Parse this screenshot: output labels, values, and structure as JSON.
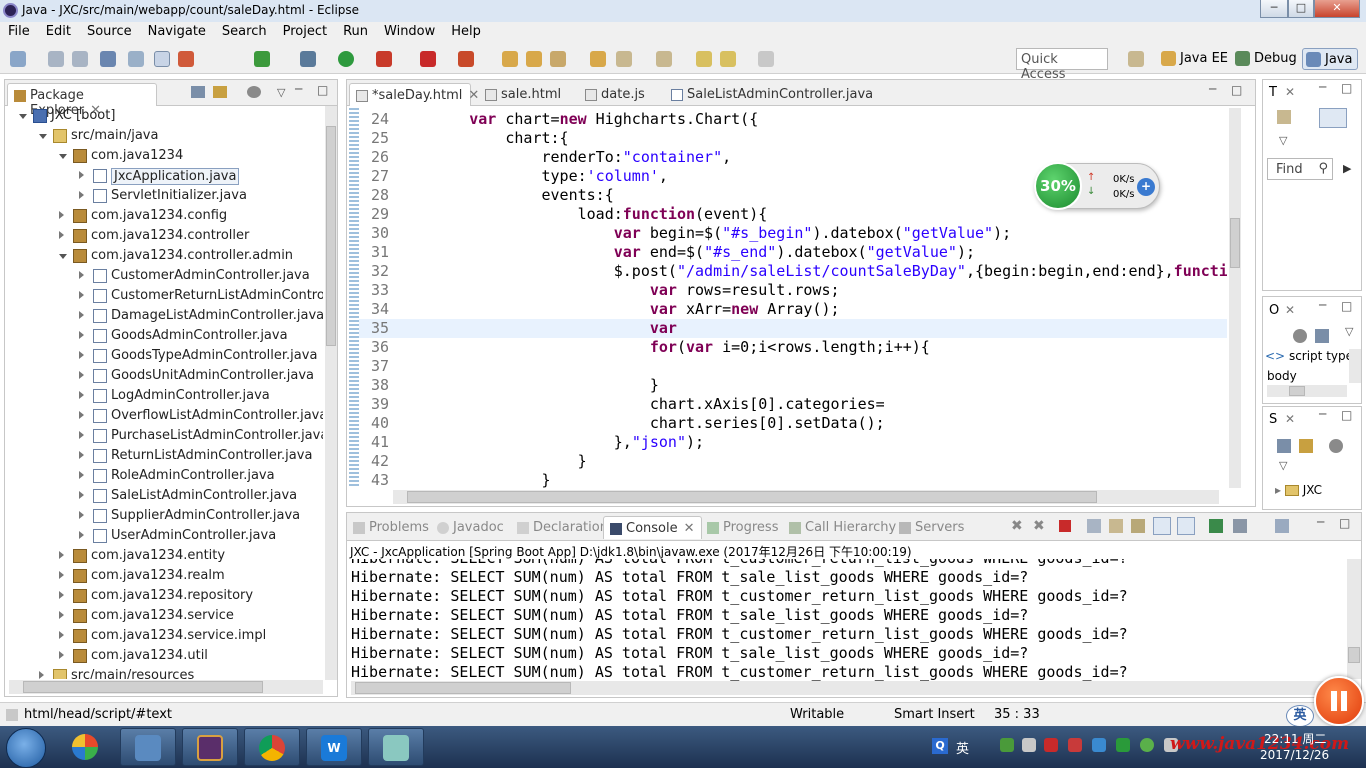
{
  "window": {
    "title": "Java - JXC/src/main/webapp/count/saleDay.html - Eclipse",
    "min_label": "─",
    "max_label": "□",
    "close_label": "✕"
  },
  "menu": [
    "File",
    "Edit",
    "Source",
    "Navigate",
    "Search",
    "Project",
    "Run",
    "Window",
    "Help"
  ],
  "toolbar": {
    "quick_access_placeholder": "Quick Access"
  },
  "perspectives": [
    "Java EE",
    "Debug",
    "Java"
  ],
  "package_explorer": {
    "title": "Package Explorer",
    "items": [
      {
        "label": "JXC [boot]",
        "type": "project"
      },
      {
        "label": "src/main/java",
        "type": "folder"
      },
      {
        "label": "com.java1234",
        "type": "package"
      },
      {
        "label": "JxcApplication.java",
        "type": "java"
      },
      {
        "label": "ServletInitializer.java",
        "type": "java"
      },
      {
        "label": "com.java1234.config",
        "type": "package"
      },
      {
        "label": "com.java1234.controller",
        "type": "package"
      },
      {
        "label": "com.java1234.controller.admin",
        "type": "package"
      },
      {
        "label": "CustomerAdminController.java",
        "type": "java"
      },
      {
        "label": "CustomerReturnListAdminController.ja",
        "type": "java"
      },
      {
        "label": "DamageListAdminController.java",
        "type": "java"
      },
      {
        "label": "GoodsAdminController.java",
        "type": "java"
      },
      {
        "label": "GoodsTypeAdminController.java",
        "type": "java"
      },
      {
        "label": "GoodsUnitAdminController.java",
        "type": "java"
      },
      {
        "label": "LogAdminController.java",
        "type": "java"
      },
      {
        "label": "OverflowListAdminController.java",
        "type": "java"
      },
      {
        "label": "PurchaseListAdminController.java",
        "type": "java"
      },
      {
        "label": "ReturnListAdminController.java",
        "type": "java"
      },
      {
        "label": "RoleAdminController.java",
        "type": "java"
      },
      {
        "label": "SaleListAdminController.java",
        "type": "java"
      },
      {
        "label": "SupplierAdminController.java",
        "type": "java"
      },
      {
        "label": "UserAdminController.java",
        "type": "java"
      },
      {
        "label": "com.java1234.entity",
        "type": "package"
      },
      {
        "label": "com.java1234.realm",
        "type": "package"
      },
      {
        "label": "com.java1234.repository",
        "type": "package"
      },
      {
        "label": "com.java1234.service",
        "type": "package"
      },
      {
        "label": "com.java1234.service.impl",
        "type": "package"
      },
      {
        "label": "com.java1234.util",
        "type": "package"
      },
      {
        "label": "src/main/resources",
        "type": "folder"
      }
    ]
  },
  "editor": {
    "tabs": [
      {
        "label": "*saleDay.html",
        "active": true
      },
      {
        "label": "sale.html",
        "active": false
      },
      {
        "label": "date.js",
        "active": false
      },
      {
        "label": "SaleListAdminController.java",
        "active": false
      }
    ],
    "lines": [
      {
        "n": "24",
        "segs": [
          [
            "p",
            "        "
          ],
          [
            "k",
            "var"
          ],
          [
            "p",
            " chart="
          ],
          [
            "k",
            "new"
          ],
          [
            "p",
            " Highcharts.Chart({"
          ]
        ]
      },
      {
        "n": "25",
        "segs": [
          [
            "p",
            "            chart:{"
          ]
        ]
      },
      {
        "n": "26",
        "segs": [
          [
            "p",
            "                renderTo:"
          ],
          [
            "s",
            "\"container\""
          ],
          [
            "p",
            ","
          ]
        ]
      },
      {
        "n": "27",
        "segs": [
          [
            "p",
            "                type:"
          ],
          [
            "s",
            "'column'"
          ],
          [
            "p",
            ","
          ]
        ]
      },
      {
        "n": "28",
        "segs": [
          [
            "p",
            "                events:{"
          ]
        ]
      },
      {
        "n": "29",
        "segs": [
          [
            "p",
            "                    load:"
          ],
          [
            "k",
            "function"
          ],
          [
            "p",
            "(event){"
          ]
        ]
      },
      {
        "n": "30",
        "segs": [
          [
            "p",
            "                        "
          ],
          [
            "k",
            "var"
          ],
          [
            "p",
            " begin=$("
          ],
          [
            "s",
            "\"#s_begin\""
          ],
          [
            "p",
            ").datebox("
          ],
          [
            "s",
            "\"getValue\""
          ],
          [
            "p",
            ");"
          ]
        ]
      },
      {
        "n": "31",
        "segs": [
          [
            "p",
            "                        "
          ],
          [
            "k",
            "var"
          ],
          [
            "p",
            " end=$("
          ],
          [
            "s",
            "\"#s_end\""
          ],
          [
            "p",
            ").datebox("
          ],
          [
            "s",
            "\"getValue\""
          ],
          [
            "p",
            ");"
          ]
        ]
      },
      {
        "n": "32",
        "segs": [
          [
            "p",
            "                        $.post("
          ],
          [
            "s",
            "\"/admin/saleList/countSaleByDay\""
          ],
          [
            "p",
            ",{begin:begin,end:end},"
          ],
          [
            "k",
            "functic"
          ]
        ]
      },
      {
        "n": "33",
        "segs": [
          [
            "p",
            "                            "
          ],
          [
            "k",
            "var"
          ],
          [
            "p",
            " rows=result.rows;"
          ]
        ]
      },
      {
        "n": "34",
        "segs": [
          [
            "p",
            "                            "
          ],
          [
            "k",
            "var"
          ],
          [
            "p",
            " xArr="
          ],
          [
            "k",
            "new"
          ],
          [
            "p",
            " Array();"
          ]
        ]
      },
      {
        "n": "35",
        "segs": [
          [
            "p",
            "                            "
          ],
          [
            "k",
            "var"
          ]
        ]
      },
      {
        "n": "36",
        "segs": [
          [
            "p",
            "                            "
          ],
          [
            "k",
            "for"
          ],
          [
            "p",
            "("
          ],
          [
            "k",
            "var"
          ],
          [
            "p",
            " i=0;i<rows.length;i++){"
          ]
        ]
      },
      {
        "n": "37",
        "segs": [
          [
            "p",
            ""
          ]
        ]
      },
      {
        "n": "38",
        "segs": [
          [
            "p",
            "                            }"
          ]
        ]
      },
      {
        "n": "39",
        "segs": [
          [
            "p",
            "                            chart.xAxis[0].categories="
          ]
        ]
      },
      {
        "n": "40",
        "segs": [
          [
            "p",
            "                            chart.series[0].setData();"
          ]
        ]
      },
      {
        "n": "41",
        "segs": [
          [
            "p",
            "                        },"
          ],
          [
            "s",
            "\"json\""
          ],
          [
            "p",
            ");"
          ]
        ]
      },
      {
        "n": "42",
        "segs": [
          [
            "p",
            "                    }"
          ]
        ]
      },
      {
        "n": "43",
        "segs": [
          [
            "p",
            "                }"
          ]
        ]
      }
    ]
  },
  "netmon": {
    "percent": "30%",
    "up": "0K/s",
    "down": "0K/s"
  },
  "outline_panels": {
    "t_label": "T",
    "find_placeholder": "Find",
    "o_label": "O",
    "o_items": [
      "script type",
      "body"
    ],
    "s_label": "S",
    "s_item": "JXC"
  },
  "bottom": {
    "tabs": [
      "Problems",
      "Javadoc",
      "Declaration",
      "Console",
      "Progress",
      "Call Hierarchy",
      "Servers"
    ],
    "active_tab": "Console",
    "console_header": "JXC - JxcApplication [Spring Boot App] D:\\jdk1.8\\bin\\javaw.exe (2017年12月26日 下午10:00:19)",
    "lines": [
      "Hibernate: SELECT SUM(num) AS total FROM t_customer_return_list_goods WHERE goods_id=?",
      "Hibernate: SELECT SUM(num) AS total FROM t_sale_list_goods WHERE goods_id=?",
      "Hibernate: SELECT SUM(num) AS total FROM t_customer_return_list_goods WHERE goods_id=?",
      "Hibernate: SELECT SUM(num) AS total FROM t_sale_list_goods WHERE goods_id=?",
      "Hibernate: SELECT SUM(num) AS total FROM t_customer_return_list_goods WHERE goods_id=?",
      "Hibernate: SELECT SUM(num) AS total FROM t_sale_list_goods WHERE goods_id=?",
      "Hibernate: SELECT SUM(num) AS total FROM t_customer_return_list_goods WHERE goods_id=?"
    ]
  },
  "status": {
    "path": "html/head/script/#text",
    "mode": "Writable",
    "insert": "Smart Insert",
    "pos": "35 : 33",
    "ime": "英"
  },
  "taskbar": {
    "ime": "英",
    "watermark": "www.java1234.com",
    "time": "22:11 周二",
    "date": "2017/12/26"
  },
  "colors": {
    "keyword": "#7f0055",
    "string": "#2a00ff",
    "title_bg": "#dbe6f3",
    "taskbar": "#2a4466"
  }
}
